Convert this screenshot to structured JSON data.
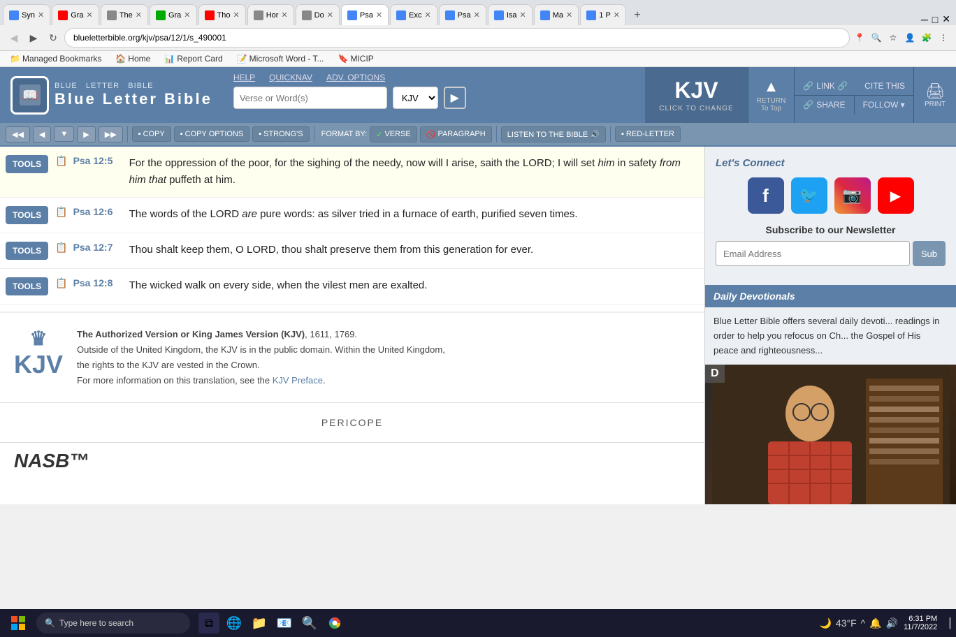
{
  "browser": {
    "tabs": [
      {
        "id": 1,
        "label": "Syn",
        "color": "#4285f4",
        "active": false
      },
      {
        "id": 2,
        "label": "Gra",
        "color": "#ff0000",
        "active": false
      },
      {
        "id": 3,
        "label": "The",
        "color": "#888",
        "active": false
      },
      {
        "id": 4,
        "label": "Gra",
        "color": "#0a0",
        "active": false
      },
      {
        "id": 5,
        "label": "Tho",
        "color": "#ff0000",
        "active": false
      },
      {
        "id": 6,
        "label": "Hor",
        "color": "#888",
        "active": false
      },
      {
        "id": 7,
        "label": "Do",
        "color": "#888",
        "active": false
      },
      {
        "id": 8,
        "label": "Psa",
        "color": "#4285f4",
        "active": true
      },
      {
        "id": 9,
        "label": "Exc",
        "color": "#4285f4",
        "active": false
      },
      {
        "id": 10,
        "label": "Psa",
        "color": "#4285f4",
        "active": false
      },
      {
        "id": 11,
        "label": "Isa",
        "color": "#4285f4",
        "active": false
      },
      {
        "id": 12,
        "label": "Ma",
        "color": "#4285f4",
        "active": false
      },
      {
        "id": 13,
        "label": "1 P",
        "color": "#4285f4",
        "active": false
      }
    ],
    "address": "blueletterbible.org/kjv/psa/12/1/s_490001",
    "bookmarks": [
      {
        "label": "Managed Bookmarks"
      },
      {
        "label": "Home"
      },
      {
        "label": "Report Card"
      },
      {
        "label": "Microsoft Word - T..."
      },
      {
        "label": "MICIP"
      }
    ]
  },
  "site": {
    "title": "Blue Letter Bible",
    "logo_text_blue": "BLUE",
    "logo_text_letter": "LETTER",
    "logo_text_bible": "BIBLE",
    "header_links": {
      "help": "HELP",
      "quicknav": "QUICKNAV",
      "adv_options": "ADV. OPTIONS"
    },
    "search": {
      "placeholder": "Verse or Word(s)",
      "version": "KJV"
    },
    "kjv_box": {
      "main": "KJV",
      "sub": "CLICK TO CHANGE"
    },
    "return_to_top": "RETURN\nTo Top",
    "link_label": "LINK 🔗",
    "cite_label": "CITE THIS",
    "share_label": "SHARE 🔗",
    "follow_label": "FOLLOW ▾",
    "print_label": "PRINT"
  },
  "toolbar": {
    "nav_buttons": [
      "◀◀",
      "◀",
      "▼",
      "▶",
      "▶▶"
    ],
    "copy": "COPY",
    "copy_options": "COPY OPTIONS",
    "strongs": "STRONG'S",
    "format_by": "FORMAT BY:",
    "verse": "VERSE",
    "paragraph": "PARAGRAPH",
    "listen": "LISTEN TO THE BIBLE 🔊",
    "red_letter": "RED-LETTER"
  },
  "verses": [
    {
      "ref": "Psa 12:5",
      "text": "For the oppression of the poor, for the sighing of the needy, now will I arise, saith the LORD; I will set him in safety from him that puffeth at him.",
      "highlighted": true,
      "italic_words": [
        "him",
        "from",
        "him",
        "that"
      ]
    },
    {
      "ref": "Psa 12:6",
      "text": "The words of the LORD are pure words: as silver tried in a furnace of earth, purified seven times.",
      "highlighted": false,
      "italic_words": [
        "are"
      ]
    },
    {
      "ref": "Psa 12:7",
      "text": "Thou shalt keep them, O LORD, thou shalt preserve them from this generation for ever.",
      "highlighted": false
    },
    {
      "ref": "Psa 12:8",
      "text": "The wicked walk on every side, when the vilest men are exalted.",
      "highlighted": false
    }
  ],
  "footer": {
    "kjv_logo": "KJV",
    "crown": "♛",
    "authorized_version": "The Authorized Version or King James Version (KJV)",
    "year": ", 1611, 1769.",
    "line1": "Outside of the United Kingdom, the KJV is in the public domain. Within the United Kingdom,",
    "line2": "the rights to the KJV are vested in the Crown.",
    "line3": "For more information on this translation, see the",
    "kjv_preface": "KJV Preface",
    "period": "."
  },
  "pericope": {
    "label": "PERICOPE"
  },
  "nasb": {
    "logo": "NASB™"
  },
  "right_panel": {
    "lets_connect": "Let's Connect",
    "newsletter_title": "Subscribe to our Newsletter",
    "email_placeholder": "Email Address",
    "sub_button": "Sub",
    "daily_devos_title": "Daily Devotionals",
    "daily_devos_text": "Blue Letter Bible offers several daily devoti... readings in order to help you refocus on Ch... the Gospel of His peace and righteousness...",
    "video_overlay": "D"
  },
  "taskbar": {
    "search_placeholder": "Type here to search",
    "time": "6:31 PM",
    "date": "11/7/2022",
    "icons": [
      "⊞",
      "🔍",
      "⬡",
      "📁",
      "🌐",
      "📧",
      "🔎",
      "🌍"
    ],
    "sys_icons": [
      "🌙",
      "43°F",
      "^",
      "🔔",
      "🔊"
    ]
  }
}
